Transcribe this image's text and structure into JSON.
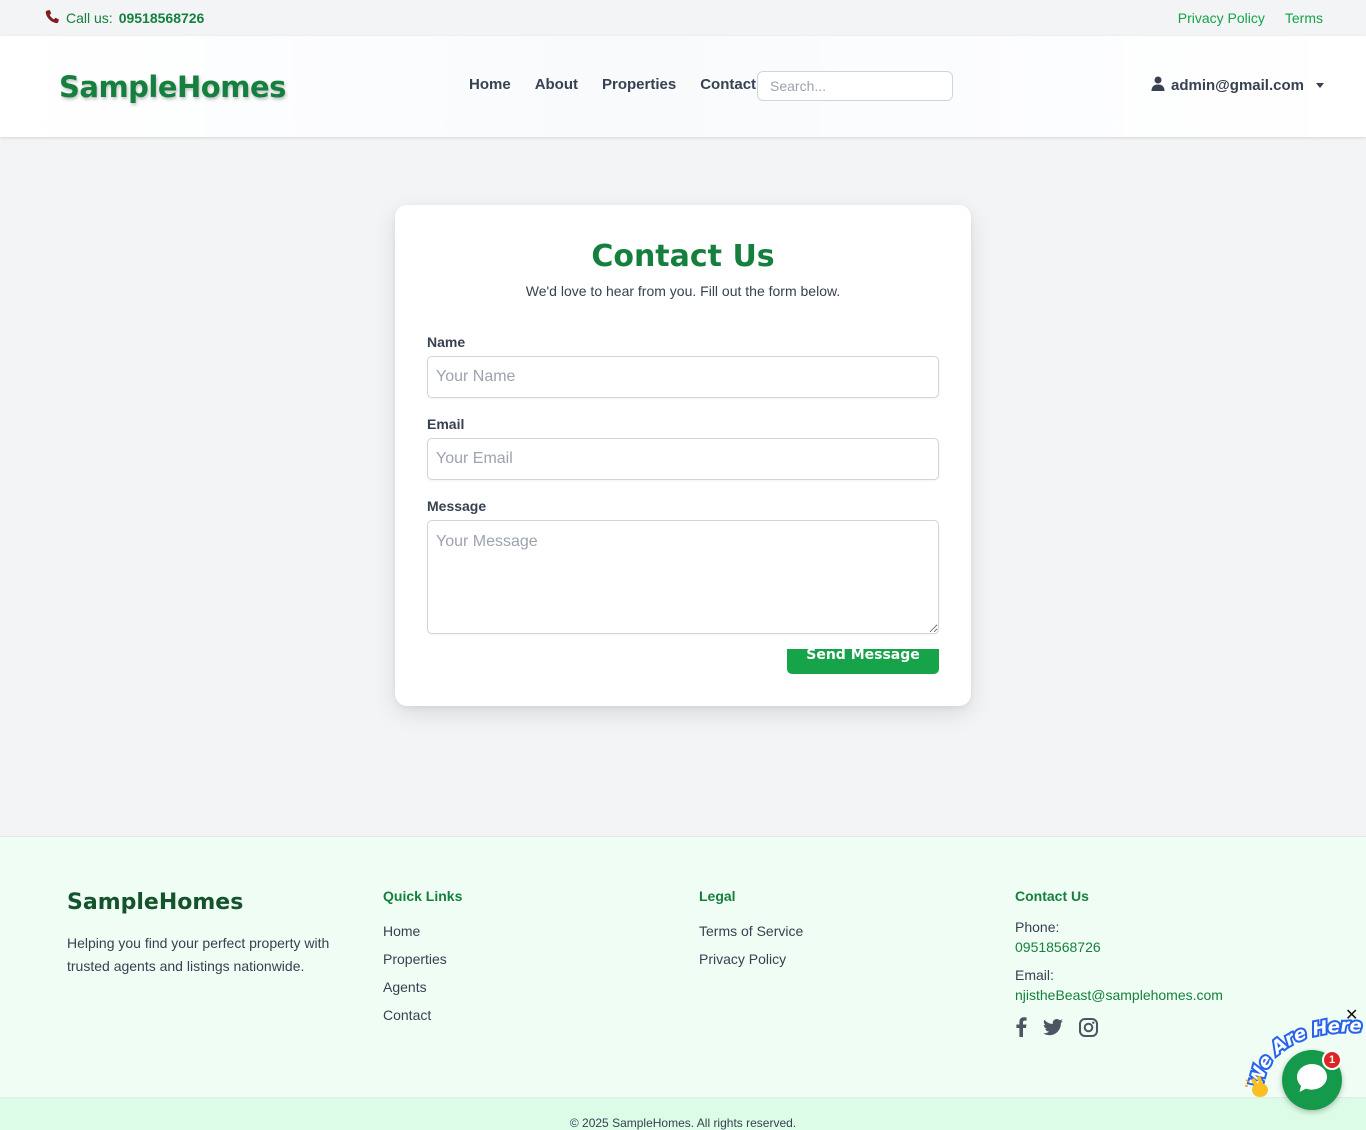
{
  "topbar": {
    "call_prefix": "Call us:",
    "phone": "09518568726",
    "links": [
      "Privacy Policy",
      "Terms"
    ]
  },
  "header": {
    "logo": "SampleHomes",
    "nav": [
      "Home",
      "About",
      "Properties",
      "Contact"
    ],
    "search_placeholder": "Search...",
    "user_email": "admin@gmail.com"
  },
  "contact_form": {
    "title": "Contact Us",
    "subtitle": "We'd love to hear from you. Fill out the form below.",
    "name_label": "Name",
    "name_placeholder": "Your Name",
    "email_label": "Email",
    "email_placeholder": "Your Email",
    "message_label": "Message",
    "message_placeholder": "Your Message",
    "submit_label": "Send Message"
  },
  "footer": {
    "brand": "SampleHomes",
    "description": "Helping you find your perfect property with trusted agents and listings nationwide.",
    "quick_links": {
      "heading": "Quick Links",
      "items": [
        "Home",
        "Properties",
        "Agents",
        "Contact"
      ]
    },
    "legal": {
      "heading": "Legal",
      "items": [
        "Terms of Service",
        "Privacy Policy"
      ]
    },
    "contact": {
      "heading": "Contact Us",
      "phone_label": "Phone:",
      "phone": "09518568726",
      "email_label": "Email:",
      "email": "njistheBeast@samplehomes.com"
    },
    "socials": [
      "facebook-icon",
      "twitter-icon",
      "instagram-icon"
    ],
    "copyright": "© 2025 SampleHomes. All rights reserved."
  },
  "chat_widget": {
    "tag_text": "We Are Here!",
    "badge_count": "1",
    "close_label": "✕"
  },
  "colors": {
    "brand_green": "#15803d",
    "button_green": "#16a34a",
    "footer_bg": "#f0fdf4"
  }
}
